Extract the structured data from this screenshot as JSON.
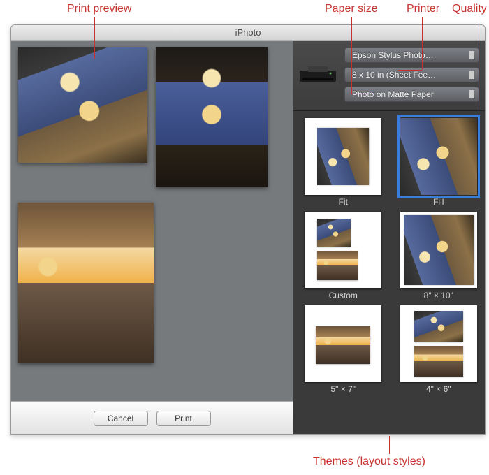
{
  "colors": {
    "annotation": "#c8322e",
    "selection": "#3a7de0"
  },
  "annotations": {
    "print_preview": "Print preview",
    "paper_size": "Paper size",
    "printer": "Printer",
    "quality": "Quality",
    "themes": "Themes (layout styles)"
  },
  "window": {
    "title": "iPhoto"
  },
  "settings": {
    "printer": {
      "label": "Epson Stylus Photo…"
    },
    "paper_size": {
      "label": "8 x 10 in (Sheet Fee…"
    },
    "quality": {
      "label": "Photo on Matte Paper"
    }
  },
  "themes": [
    {
      "id": "fit",
      "label": "Fit",
      "selected": false
    },
    {
      "id": "fill",
      "label": "Fill",
      "selected": true
    },
    {
      "id": "custom",
      "label": "Custom",
      "selected": false
    },
    {
      "id": "8x10",
      "label": "8\" × 10\"",
      "selected": false
    },
    {
      "id": "5x7",
      "label": "5\" × 7\"",
      "selected": false
    },
    {
      "id": "4x6",
      "label": "4\" × 6\"",
      "selected": false
    }
  ],
  "buttons": {
    "cancel": "Cancel",
    "print": "Print"
  }
}
